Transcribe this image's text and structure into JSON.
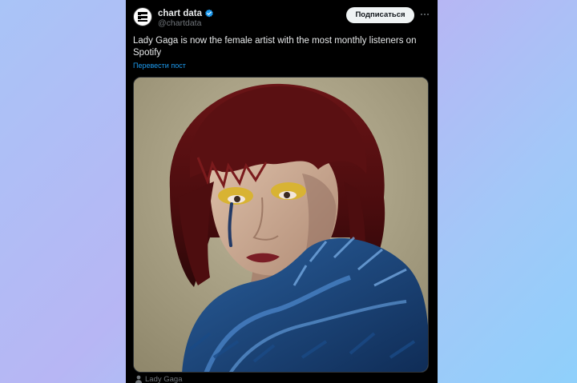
{
  "account": {
    "display_name": "chart data",
    "handle": "@chartdata",
    "verified": true,
    "avatar_icon": "chartdata-logo-icon"
  },
  "actions": {
    "subscribe_label": "Подписаться",
    "more_icon": "more-dots-icon"
  },
  "post": {
    "text": "Lady Gaga is now the female artist with the most monthly listeners on Spotify",
    "translate_label": "Перевести пост"
  },
  "media": {
    "description": "portrait photo",
    "caption": "Lady Gaga",
    "caption_icon": "person-icon"
  },
  "colors": {
    "background": "#000000",
    "text": "#e7e9ea",
    "secondary": "#71767b",
    "link": "#1d9bf0",
    "verified": "#1d9bf0"
  }
}
